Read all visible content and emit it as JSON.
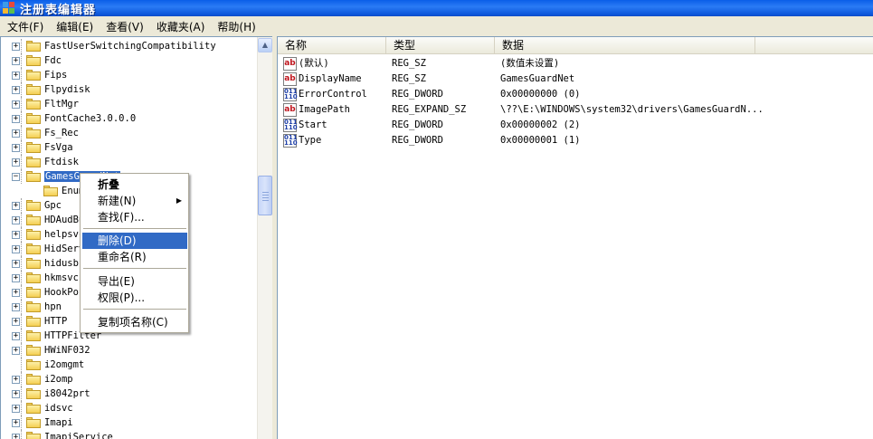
{
  "window": {
    "title": "注册表编辑器"
  },
  "menu": [
    "文件(F)",
    "编辑(E)",
    "查看(V)",
    "收藏夹(A)",
    "帮助(H)"
  ],
  "tree": [
    {
      "label": "FastUserSwitchingCompatibility",
      "expander": "+"
    },
    {
      "label": "Fdc",
      "expander": "+"
    },
    {
      "label": "Fips",
      "expander": "+"
    },
    {
      "label": "Flpydisk",
      "expander": "+"
    },
    {
      "label": "FltMgr",
      "expander": "+"
    },
    {
      "label": "FontCache3.0.0.0",
      "expander": "+"
    },
    {
      "label": "Fs_Rec",
      "expander": "+"
    },
    {
      "label": "FsVga",
      "expander": "+"
    },
    {
      "label": "Ftdisk",
      "expander": "+"
    },
    {
      "label": "GamesGuardNet",
      "expander": "−",
      "selected": true
    },
    {
      "label": "Enum",
      "expander": "",
      "child": true
    },
    {
      "label": "Gpc",
      "expander": "+"
    },
    {
      "label": "HDAudBus",
      "expander": "+"
    },
    {
      "label": "helpsvc",
      "expander": "+"
    },
    {
      "label": "HidServ",
      "expander": "+"
    },
    {
      "label": "hidusb",
      "expander": "+"
    },
    {
      "label": "hkmsvc",
      "expander": "+"
    },
    {
      "label": "HookPort",
      "expander": "+"
    },
    {
      "label": "hpn",
      "expander": "+"
    },
    {
      "label": "HTTP",
      "expander": "+"
    },
    {
      "label": "HTTPFilter",
      "expander": "+"
    },
    {
      "label": "HWiNF032",
      "expander": "+"
    },
    {
      "label": "i2omgmt",
      "expander": ""
    },
    {
      "label": "i2omp",
      "expander": "+"
    },
    {
      "label": "i8042prt",
      "expander": "+"
    },
    {
      "label": "idsvc",
      "expander": "+"
    },
    {
      "label": "Imapi",
      "expander": "+"
    },
    {
      "label": "ImapiService",
      "expander": "+"
    }
  ],
  "list": {
    "headers": [
      "名称",
      "类型",
      "数据"
    ],
    "rows": [
      {
        "icon": "string-value-icon",
        "name": "(默认)",
        "type": "REG_SZ",
        "data": "(数值未设置)"
      },
      {
        "icon": "string-value-icon",
        "name": "DisplayName",
        "type": "REG_SZ",
        "data": "GamesGuardNet"
      },
      {
        "icon": "binary-value-icon",
        "name": "ErrorControl",
        "type": "REG_DWORD",
        "data": "0x00000000 (0)"
      },
      {
        "icon": "string-value-icon",
        "name": "ImagePath",
        "type": "REG_EXPAND_SZ",
        "data": "\\??\\E:\\WINDOWS\\system32\\drivers\\GamesGuardN..."
      },
      {
        "icon": "binary-value-icon",
        "name": "Start",
        "type": "REG_DWORD",
        "data": "0x00000002 (2)"
      },
      {
        "icon": "binary-value-icon",
        "name": "Type",
        "type": "REG_DWORD",
        "data": "0x00000001 (1)"
      }
    ]
  },
  "context_menu": {
    "collapse": "折叠",
    "new": "新建(N)",
    "find": "查找(F)...",
    "delete": "删除(D)",
    "rename": "重命名(R)",
    "export": "导出(E)",
    "permissions": "权限(P)...",
    "copy_key_name": "复制项名称(C)"
  },
  "colors": {
    "selection": "#316ac5",
    "titlebar": "#0a5ee8"
  }
}
